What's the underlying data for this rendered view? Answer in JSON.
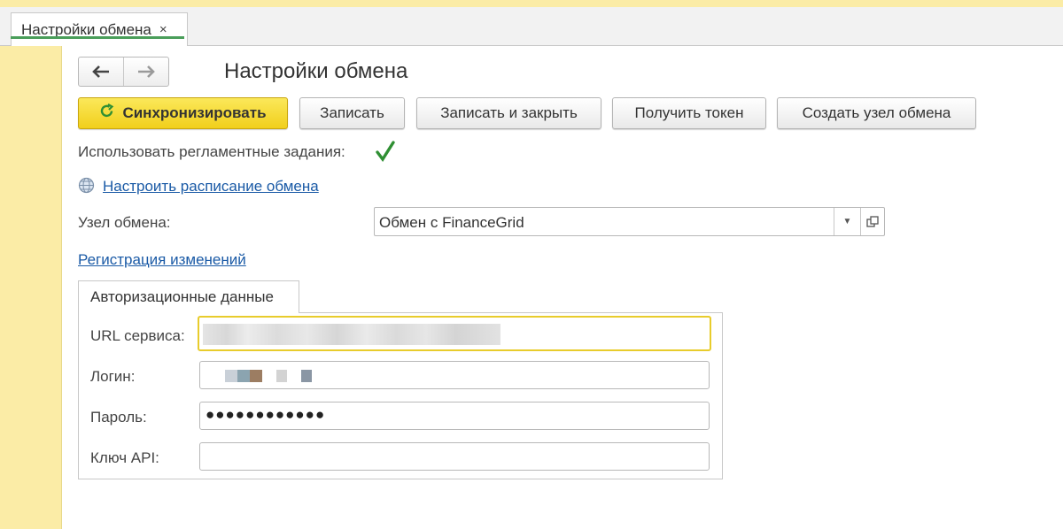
{
  "window": {
    "tab_title": "Настройки обмена",
    "tab_close": "×"
  },
  "form": {
    "title": "Настройки обмена",
    "nav": {
      "back": "🡐",
      "forward": "🡒"
    }
  },
  "toolbar": {
    "sync_label": "Синхронизировать",
    "save_label": "Записать",
    "save_close_label": "Записать и закрыть",
    "get_token_label": "Получить токен",
    "create_node_label": "Создать узел обмена"
  },
  "settings": {
    "use_scheduled_label": "Использовать регламентные задания:",
    "use_scheduled_checked": true,
    "schedule_link": "Настроить расписание обмена",
    "node_label": "Узел обмена:",
    "node_value": "Обмен с FinanceGrid",
    "changes_link": "Регистрация изменений"
  },
  "auth": {
    "tab_label": "Авторизационные данные",
    "url_label": "URL сервиса:",
    "url_value": "",
    "login_label": "Логин:",
    "login_value": "",
    "password_label": "Пароль:",
    "password_value": "●●●●●●●●●●●●",
    "api_key_label": "Ключ API:",
    "api_key_value": ""
  },
  "colors": {
    "primary_button": "#f1cf1c",
    "sidebar": "#fbeca6",
    "link": "#1a5aa6",
    "check": "#2f8f33",
    "focus_border": "#e8cc2c"
  },
  "icons": {
    "sync": "refresh-icon",
    "check": "checkmark-icon",
    "schedule": "globe-icon",
    "dropdown": "chevron-down-icon",
    "open": "open-form-icon"
  }
}
